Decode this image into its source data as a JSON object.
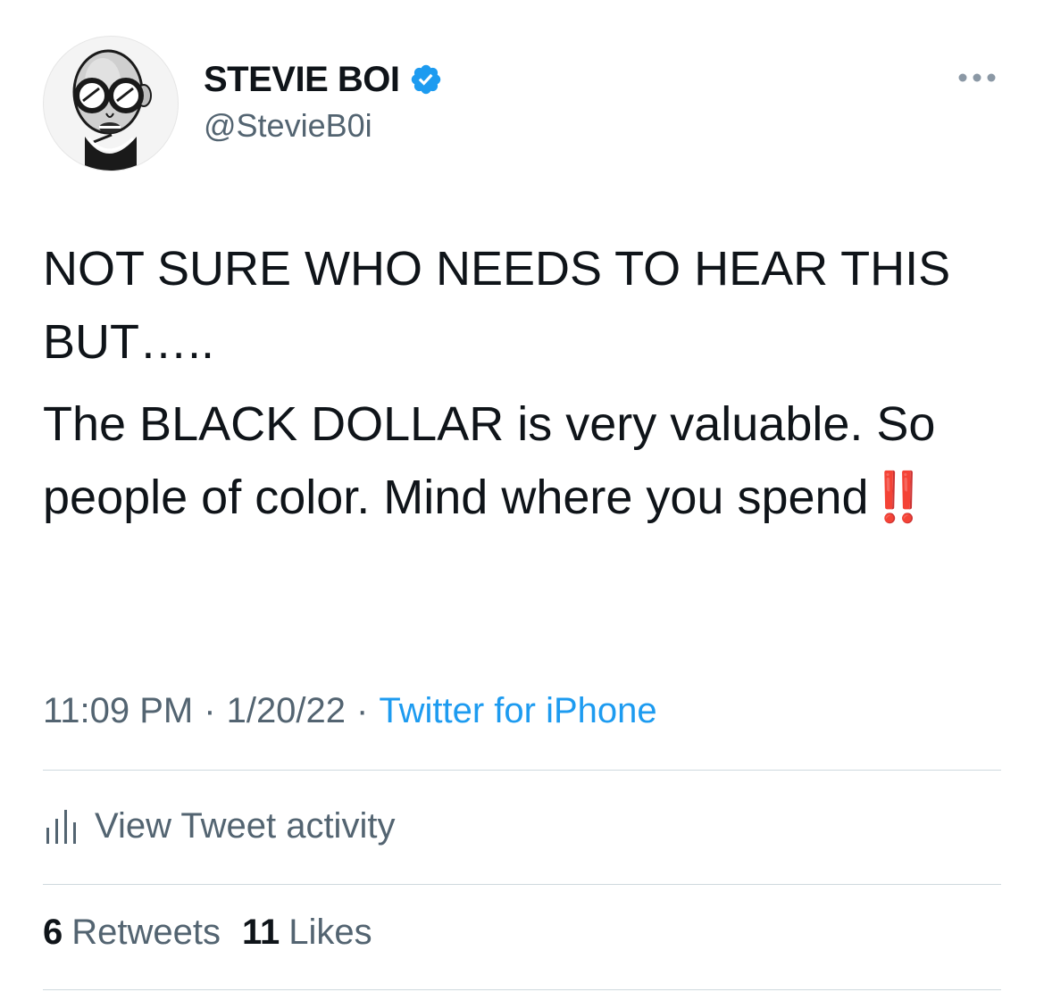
{
  "user": {
    "display_name": "STEVIE BOI",
    "handle": "@StevieB0i",
    "verified": true,
    "verified_color": "#1d9bf0",
    "avatar_icon": "avatar-illustration"
  },
  "tweet": {
    "line1": "NOT SURE WHO NEEDS TO HEAR THIS BUT…..",
    "line2_text": "The BLACK DOLLAR is very valuable. So people of color. Mind where you spend",
    "line2_emoji": "‼️",
    "emoji_color": "#e0271e"
  },
  "meta": {
    "time": "11:09 PM",
    "separator": "·",
    "date": "1/20/22",
    "source": "Twitter for iPhone",
    "source_color": "#1d9bf0"
  },
  "activity": {
    "label": "View Tweet activity",
    "icon": "analytics-bars-icon"
  },
  "stats": {
    "retweets_count": "6",
    "retweets_label": "Retweets",
    "likes_count": "11",
    "likes_label": "Likes"
  },
  "menu": {
    "icon": "more-options-icon"
  }
}
